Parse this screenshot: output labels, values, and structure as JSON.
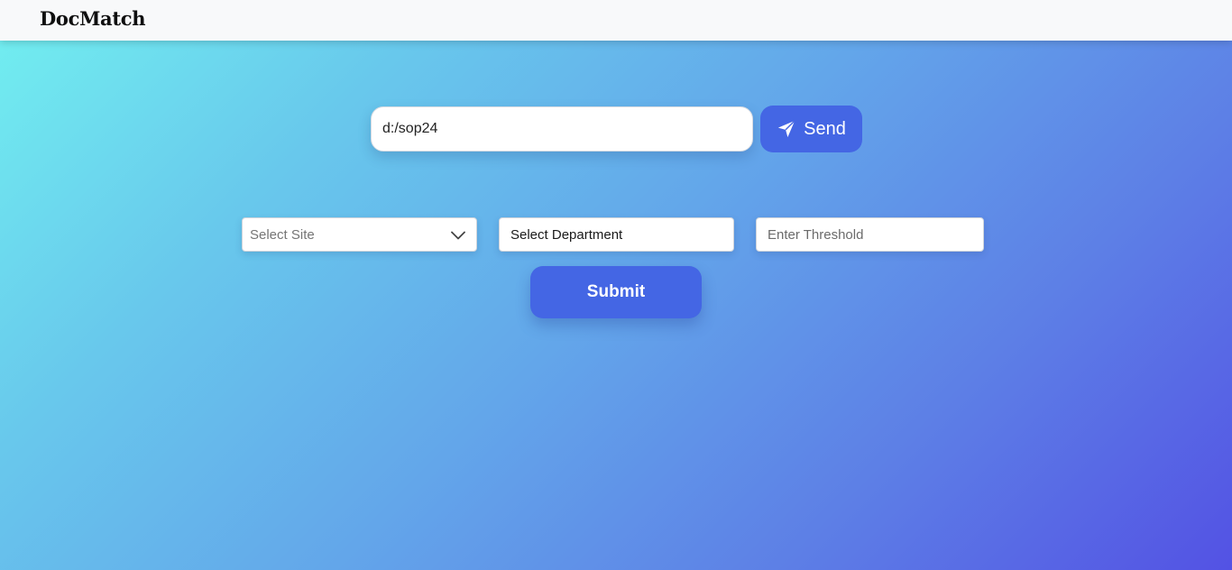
{
  "navbar": {
    "brand": "DocMatch"
  },
  "path_bar": {
    "value": "d:/sop24",
    "send_label": "Send",
    "send_icon": "paper-plane-icon"
  },
  "filters": {
    "site_placeholder": "Select Site",
    "site_icon": "chevron-down-icon",
    "department_value": "Select Department",
    "threshold_placeholder": "Enter Threshold"
  },
  "submit_label": "Submit",
  "colors": {
    "accent": "#4466e4",
    "navbar_bg": "#f8f9fa",
    "gradient_start": "#72f0f0",
    "gradient_end": "#5352e4"
  }
}
